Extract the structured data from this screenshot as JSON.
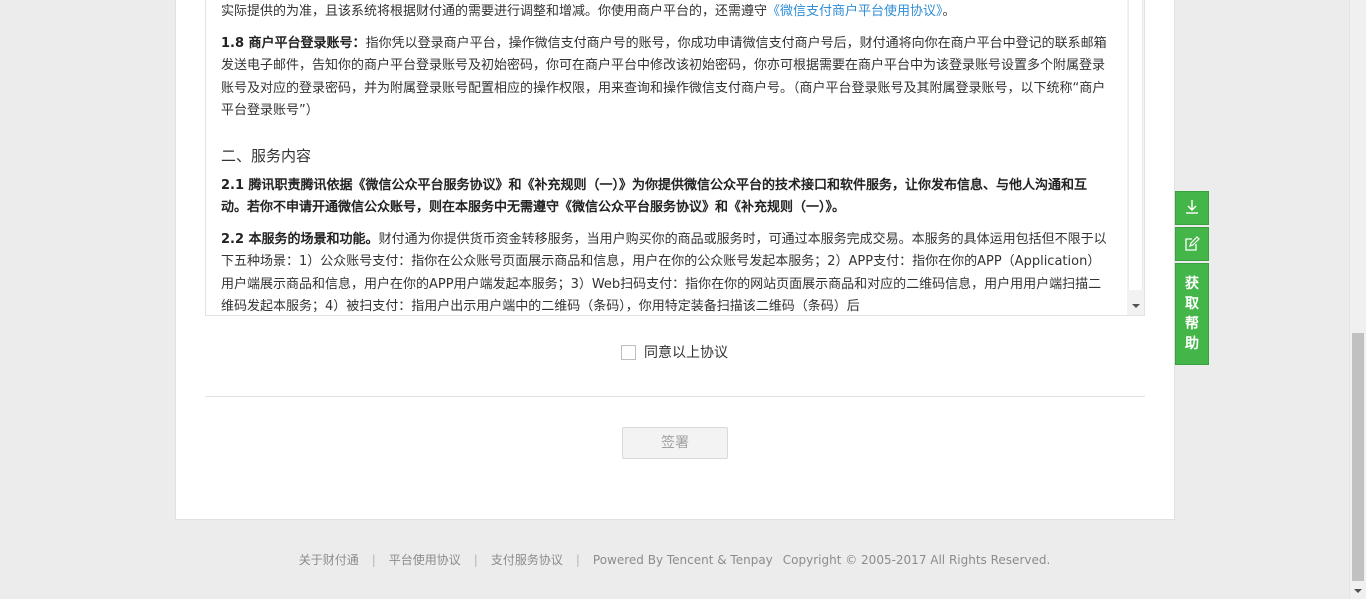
{
  "agreement": {
    "p_intro_text": "实际提供的为准，且该系统将根据财付通的需要进行调整和增减。你使用商户平台的，还需遵守",
    "p_intro_link": "《微信支付商户平台使用协议》",
    "p_intro_end": "。",
    "p_1_8_title": "1.8 商户平台登录账号：",
    "p_1_8_body": "指你凭以登录商户平台，操作微信支付商户号的账号，你成功申请微信支付商户号后，财付通将向你在商户平台中登记的联系邮箱发送电子邮件，告知你的商户平台登录账号及初始密码，你可在商户平台中修改该初始密码，你亦可根据需要在商户平台中为该登录账号设置多个附属登录账号及对应的登录密码，并为附属登录账号配置相应的操作权限，用来查询和操作微信支付商户号。（商户平台登录账号及其附属登录账号，以下统称“商户平台登录账号”）",
    "section_2_title": "二、服务内容",
    "p_2_1": "2.1 腾讯职责腾讯依据《微信公众平台服务协议》和《补充规则（一）》为你提供微信公众平台的技术接口和软件服务，让你发布信息、与他人沟通和互动。若你不申请开通微信公众账号，则在本服务中无需遵守《微信公众平台服务协议》和《补充规则（一）》。",
    "p_2_2_title": "2.2 本服务的场景和功能。",
    "p_2_2_body": "财付通为你提供货币资金转移服务，当用户购买你的商品或服务时，可通过本服务完成交易。本服务的具体运用包括但不限于以下五种场景：1）公众账号支付：指你在公众账号页面展示商品和信息，用户在你的公众账号发起本服务；2）APP支付：指你在你的APP（Application）用户端展示商品和信息，用户在你的APP用户端发起本服务；3）Web扫码支付：指你在你的网站页面展示商品和对应的二维码信息，用户用用户端扫描二维码发起本服务；4）被扫支付：指用户出示用户端中的二维码（条码），你用特定装备扫描该二维码（条码）后"
  },
  "agree_label": "同意以上协议",
  "sign_label": "签署",
  "side_tools": {
    "help_chars": [
      "获",
      "取",
      "帮",
      "助"
    ]
  },
  "footer": {
    "links": [
      "关于财付通",
      "平台使用协议",
      "支付服务协议"
    ],
    "separator": "|",
    "powered": "Powered By Tencent & Tenpay",
    "copyright": "Copyright © 2005-2017 All Rights Reserved."
  },
  "colors": {
    "accent_green": "#44b549",
    "link_blue": "#2f8ed6"
  }
}
